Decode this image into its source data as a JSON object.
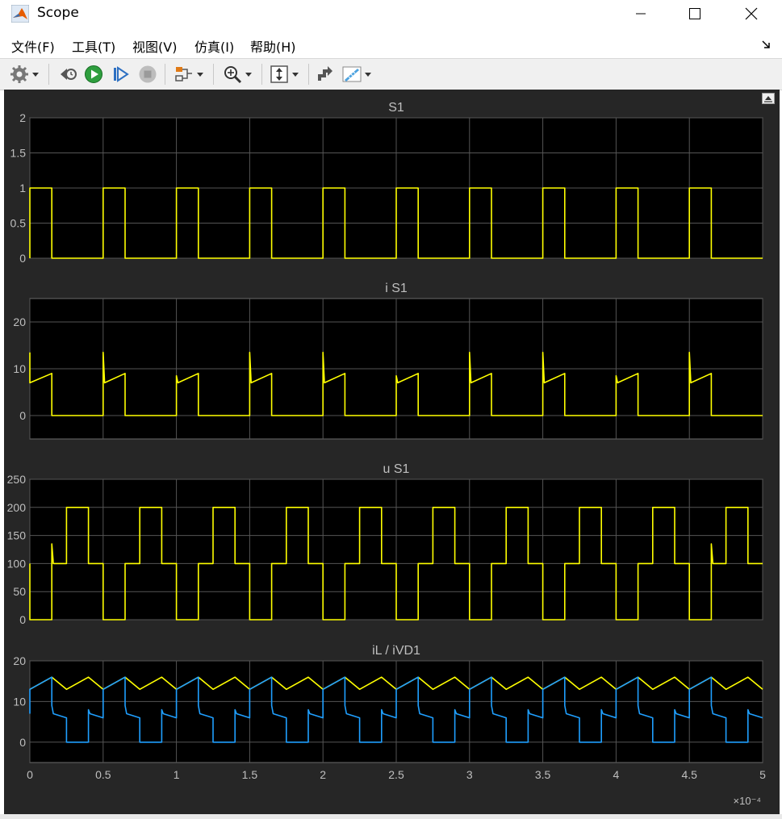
{
  "window": {
    "title": "Scope"
  },
  "menu": [
    "文件(F)",
    "工具(T)",
    "视图(V)",
    "仿真(I)",
    "帮助(H)"
  ],
  "toolbar": {
    "buttons": [
      "settings-icon",
      "step-back-icon",
      "run-icon",
      "step-forward-icon",
      "stop-icon",
      "signal-select-icon",
      "zoom-icon",
      "autoscale-icon",
      "highlight-simulink-icon",
      "measurements-icon"
    ]
  },
  "colors": {
    "background": "#262626",
    "axes": "#000000",
    "grid": "#555555",
    "text": "#bfbfbf",
    "signal_yellow": "#ffff00",
    "signal_blue": "#1f9fff"
  },
  "chart_data": [
    {
      "type": "line",
      "title": "S1",
      "ylim": [
        0,
        2
      ],
      "yticks": [
        "0",
        "0.5",
        "1",
        "1.5",
        "2"
      ],
      "xlim": [
        0,
        5
      ],
      "description_period": 0.5,
      "series": [
        {
          "color": "#ffff00",
          "x": [
            0,
            0,
            0.15,
            0.15,
            0.5,
            0.5,
            0.65,
            0.65,
            1.0,
            1.0,
            1.15,
            1.15,
            1.5,
            1.5,
            1.65,
            1.65,
            2.0,
            2.0,
            2.15,
            2.15,
            2.5,
            2.5,
            2.65,
            2.65,
            3.0,
            3.0,
            3.15,
            3.15,
            3.5,
            3.5,
            3.65,
            3.65,
            4.0,
            4.0,
            4.15,
            4.15,
            4.5,
            4.5,
            4.65,
            4.65,
            5.0
          ],
          "y": [
            0,
            1,
            1,
            0,
            0,
            1,
            1,
            0,
            0,
            1,
            1,
            0,
            0,
            1,
            1,
            0,
            0,
            1,
            1,
            0,
            0,
            1,
            1,
            0,
            0,
            1,
            1,
            0,
            0,
            1,
            1,
            0,
            0,
            1,
            1,
            0,
            0,
            1,
            1,
            0,
            0
          ]
        }
      ]
    },
    {
      "type": "line",
      "title": "i S1",
      "ylim": [
        -5,
        25
      ],
      "yticks": [
        "0",
        "10",
        "20"
      ],
      "xlim": [
        0,
        5
      ],
      "series": [
        {
          "color": "#ffff00",
          "x": [
            0,
            0,
            0.15,
            0.15,
            0.5,
            0.5,
            0.51,
            0.65,
            0.65,
            1.0,
            1.0,
            1.01,
            1.15,
            1.15,
            1.5,
            1.5,
            1.51,
            1.65,
            1.65,
            2.0,
            2.0,
            2.01,
            2.15,
            2.15,
            2.5,
            2.5,
            2.51,
            2.65,
            2.65,
            3.0,
            3.0,
            3.01,
            3.15,
            3.15,
            3.5,
            3.5,
            3.51,
            3.65,
            3.65,
            4.0,
            4.0,
            4.01,
            4.15,
            4.15,
            4.5,
            4.5,
            4.51,
            4.65,
            4.65,
            5.0
          ],
          "y": [
            13.5,
            7,
            9,
            0,
            0,
            13.5,
            7,
            9,
            0,
            0,
            8.5,
            7,
            9,
            0,
            0,
            13.5,
            7,
            9,
            0,
            0,
            13.5,
            7,
            9,
            0,
            0,
            8.5,
            7,
            9,
            0,
            0,
            13.5,
            7,
            9,
            0,
            0,
            13.5,
            7,
            9,
            0,
            0,
            8.5,
            7,
            9,
            0,
            0,
            13.5,
            7,
            9,
            0,
            0
          ]
        }
      ]
    },
    {
      "type": "line",
      "title": "u S1",
      "ylim": [
        0,
        250
      ],
      "yticks": [
        "0",
        "50",
        "100",
        "150",
        "200",
        "250"
      ],
      "xlim": [
        0,
        5
      ],
      "series": [
        {
          "color": "#ffff00",
          "x": [
            0,
            0,
            0.15,
            0.15,
            0.16,
            0.25,
            0.25,
            0.4,
            0.4,
            0.5,
            0.5,
            0.65,
            0.65,
            0.66,
            0.75,
            0.75,
            0.9,
            0.9,
            1.0,
            1.0,
            1.15,
            1.15,
            1.16,
            1.25,
            1.25,
            1.4,
            1.4,
            1.5,
            1.5,
            1.65,
            1.65,
            1.66,
            1.75,
            1.75,
            1.9,
            1.9,
            2.0,
            2.0,
            2.15,
            2.15,
            2.16,
            2.25,
            2.25,
            2.4,
            2.4,
            2.5,
            2.5,
            2.65,
            2.65,
            2.66,
            2.75,
            2.75,
            2.9,
            2.9,
            3.0,
            3.0,
            3.15,
            3.15,
            3.16,
            3.25,
            3.25,
            3.4,
            3.4,
            3.5,
            3.5,
            3.65,
            3.65,
            3.66,
            3.75,
            3.75,
            3.9,
            3.9,
            4.0,
            4.0,
            4.15,
            4.15,
            4.16,
            4.25,
            4.25,
            4.4,
            4.4,
            4.5,
            4.5,
            4.65,
            4.65,
            4.66,
            4.75,
            4.75,
            4.9,
            4.9,
            5.0
          ],
          "y": [
            100,
            0,
            0,
            135,
            100,
            100,
            200,
            200,
            100,
            100,
            0,
            0,
            100,
            100,
            100,
            200,
            200,
            100,
            100,
            0,
            0,
            100,
            100,
            100,
            200,
            200,
            100,
            100,
            0,
            0,
            100,
            100,
            100,
            200,
            200,
            100,
            100,
            0,
            0,
            100,
            100,
            100,
            200,
            200,
            100,
            100,
            0,
            0,
            100,
            100,
            100,
            200,
            200,
            100,
            100,
            0,
            0,
            100,
            100,
            100,
            200,
            200,
            100,
            100,
            0,
            0,
            100,
            100,
            100,
            200,
            200,
            100,
            100,
            0,
            0,
            100,
            100,
            100,
            200,
            200,
            100,
            100,
            0,
            0,
            135,
            100,
            100,
            200,
            200,
            100,
            100
          ]
        }
      ]
    },
    {
      "type": "line",
      "title": "iL / iVD1",
      "ylim": [
        -5,
        20
      ],
      "yticks": [
        "0",
        "10",
        "20"
      ],
      "xlim": [
        0,
        5
      ],
      "xticks": [
        "0",
        "0.5",
        "1",
        "1.5",
        "2",
        "2.5",
        "3",
        "3.5",
        "4",
        "4.5",
        "5"
      ],
      "xscale_label": "×10⁻⁴",
      "series": [
        {
          "color": "#ffff00",
          "x": [
            0,
            0.15,
            0.25,
            0.4,
            0.5,
            0.65,
            0.75,
            0.9,
            1.0,
            1.15,
            1.25,
            1.4,
            1.5,
            1.65,
            1.75,
            1.9,
            2.0,
            2.15,
            2.25,
            2.4,
            2.5,
            2.65,
            2.75,
            2.9,
            3.0,
            3.15,
            3.25,
            3.4,
            3.5,
            3.65,
            3.75,
            3.9,
            4.0,
            4.15,
            4.25,
            4.4,
            4.5,
            4.65,
            4.75,
            4.9,
            5.0
          ],
          "y": [
            13,
            16,
            13,
            16,
            13,
            16,
            13,
            16,
            13,
            16,
            13,
            16,
            13,
            16,
            13,
            16,
            13,
            16,
            13,
            16,
            13,
            16,
            13,
            16,
            13,
            16,
            13,
            16,
            13,
            16,
            13,
            16,
            13,
            16,
            13,
            16,
            13,
            16,
            13,
            16,
            13
          ]
        },
        {
          "color": "#1f9fff",
          "x": [
            0,
            0,
            0.15,
            0.15,
            0.16,
            0.25,
            0.25,
            0.4,
            0.4,
            0.41,
            0.5,
            0.5,
            0.65,
            0.65,
            0.66,
            0.75,
            0.75,
            0.9,
            0.9,
            0.91,
            1.0,
            1.0,
            1.15,
            1.15,
            1.16,
            1.25,
            1.25,
            1.4,
            1.4,
            1.41,
            1.5,
            1.5,
            1.65,
            1.65,
            1.66,
            1.75,
            1.75,
            1.9,
            1.9,
            1.91,
            2.0,
            2.0,
            2.15,
            2.15,
            2.16,
            2.25,
            2.25,
            2.4,
            2.4,
            2.41,
            2.5,
            2.5,
            2.65,
            2.65,
            2.66,
            2.75,
            2.75,
            2.9,
            2.9,
            2.91,
            3.0,
            3.0,
            3.15,
            3.15,
            3.16,
            3.25,
            3.25,
            3.4,
            3.4,
            3.41,
            3.5,
            3.5,
            3.65,
            3.65,
            3.66,
            3.75,
            3.75,
            3.9,
            3.9,
            3.91,
            4.0,
            4.0,
            4.15,
            4.15,
            4.16,
            4.25,
            4.25,
            4.4,
            4.4,
            4.41,
            4.5,
            4.5,
            4.65,
            4.65,
            4.66,
            4.75,
            4.75,
            4.9,
            4.9,
            4.91,
            5.0
          ],
          "y": [
            7,
            13,
            16,
            9,
            7,
            6,
            0,
            0,
            8,
            7,
            6,
            13,
            16,
            9,
            7,
            6,
            0,
            0,
            8,
            7,
            6,
            13,
            16,
            9,
            7,
            6,
            0,
            0,
            8,
            7,
            6,
            13,
            16,
            9,
            7,
            6,
            0,
            0,
            8,
            7,
            6,
            13,
            16,
            9,
            7,
            6,
            0,
            0,
            8,
            7,
            6,
            13,
            16,
            9,
            7,
            6,
            0,
            0,
            8,
            7,
            6,
            13,
            16,
            9,
            7,
            6,
            0,
            0,
            8,
            7,
            6,
            13,
            16,
            9,
            7,
            6,
            0,
            0,
            8,
            7,
            6,
            13,
            16,
            9,
            7,
            6,
            0,
            0,
            8,
            7,
            6,
            13,
            16,
            9,
            7,
            6,
            0,
            0,
            8,
            7,
            6
          ]
        }
      ]
    }
  ]
}
